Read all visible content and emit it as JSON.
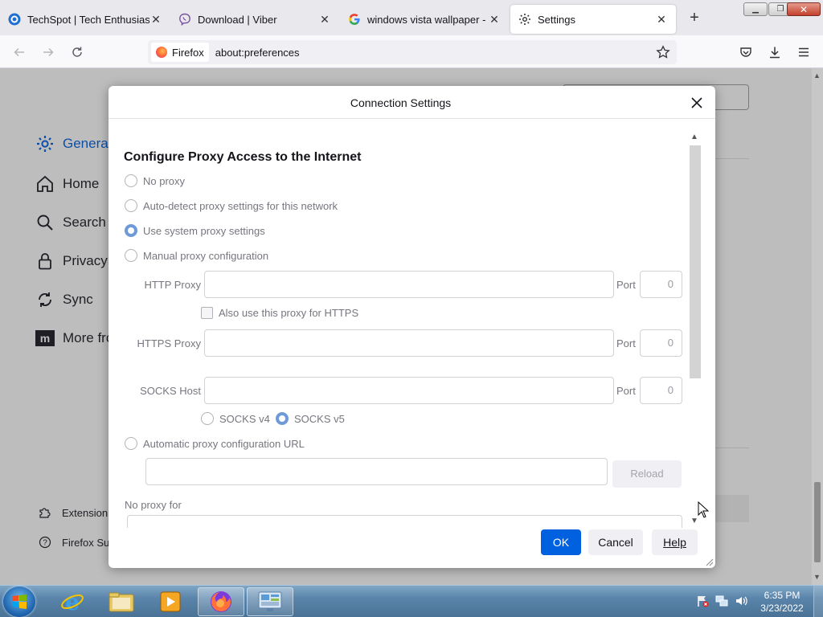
{
  "browser": {
    "tabs": [
      {
        "title": "TechSpot | Tech Enthusiasts, P",
        "icon": "techspot-icon"
      },
      {
        "title": "Download | Viber",
        "icon": "viber-icon"
      },
      {
        "title": "windows vista wallpaper - Go",
        "icon": "google-icon"
      },
      {
        "title": "Settings",
        "icon": "gear-icon",
        "active": true
      }
    ],
    "identity_label": "Firefox",
    "url": "about:preferences"
  },
  "settings_page": {
    "sidebar": [
      {
        "label": "General"
      },
      {
        "label": "Home"
      },
      {
        "label": "Search"
      },
      {
        "label": "Privacy &"
      },
      {
        "label": "Sync"
      },
      {
        "label": "More fro"
      }
    ],
    "sidebar_footer": [
      {
        "label": "Extension"
      },
      {
        "label": "Firefox Su"
      }
    ]
  },
  "dialog": {
    "title": "Connection Settings",
    "section_heading": "Configure Proxy Access to the Internet",
    "proxy_options": [
      {
        "label": "No proxy",
        "selected": false
      },
      {
        "label": "Auto-detect proxy settings for this network",
        "selected": false
      },
      {
        "label": "Use system proxy settings",
        "selected": true
      },
      {
        "label": "Manual proxy configuration",
        "selected": false
      }
    ],
    "http_proxy": {
      "label": "HTTP Proxy",
      "value": "",
      "port_label": "Port",
      "port": "0"
    },
    "also_https": {
      "label": "Also use this proxy for HTTPS",
      "checked": false
    },
    "https_proxy": {
      "label": "HTTPS Proxy",
      "value": "",
      "port_label": "Port",
      "port": "0"
    },
    "socks_host": {
      "label": "SOCKS Host",
      "value": "",
      "port_label": "Port",
      "port": "0"
    },
    "socks_versions": [
      {
        "label": "SOCKS v4",
        "selected": false
      },
      {
        "label": "SOCKS v5",
        "selected": true
      }
    ],
    "auto_url": {
      "label": "Automatic proxy configuration URL",
      "selected": false,
      "value": ""
    },
    "reload_label": "Reload",
    "no_proxy_label": "No proxy for",
    "buttons": {
      "ok": "OK",
      "cancel": "Cancel",
      "help": "Help"
    }
  },
  "taskbar": {
    "time": "6:35 PM",
    "date": "3/23/2022"
  },
  "colors": {
    "accent": "#0061e0",
    "radio_selected": "#6e9ad8",
    "sidebar_active": "#0d4fa8"
  }
}
